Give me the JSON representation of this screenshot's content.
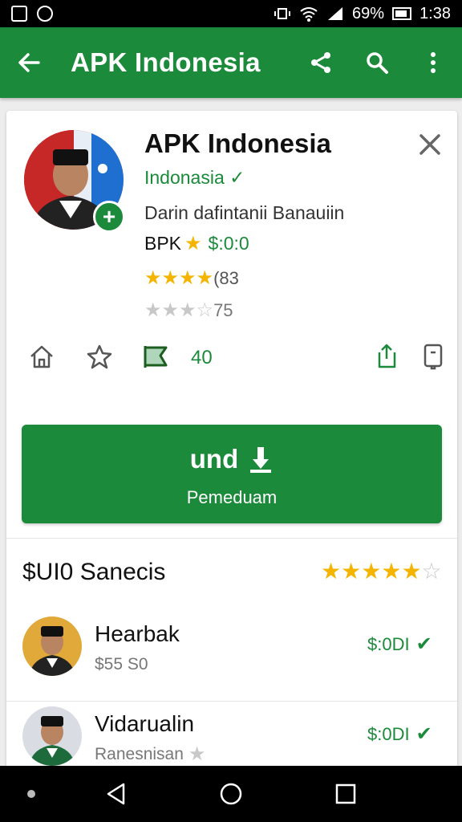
{
  "status_bar": {
    "battery_text": "69%",
    "time": "1:38"
  },
  "app_bar": {
    "title": "APK Indonesia"
  },
  "app": {
    "title": "APK Indonesia",
    "developer": "Indonasia",
    "description": "Darin dafintanii Banauiin",
    "price_label": "BPK",
    "price_value": "$:0:0",
    "rating_count_1": "(83",
    "rating_count_2": "75",
    "rating_1_stars": 4,
    "rating_2_stars": 2,
    "download_count": "40"
  },
  "install": {
    "label": "und",
    "sublabel": "Pemeduam"
  },
  "reviews_section": {
    "title": "$UI0 Sanecis",
    "stars": 5
  },
  "reviews": [
    {
      "name": "Hearbak",
      "sub": "$55 S0",
      "price": "$:0DI"
    },
    {
      "name": "Vidarualin",
      "sub": "Ranesnisan",
      "price": "$:0DI"
    }
  ],
  "colors": {
    "brand_green": "#1b8a3a",
    "star_gold": "#f4b400"
  }
}
